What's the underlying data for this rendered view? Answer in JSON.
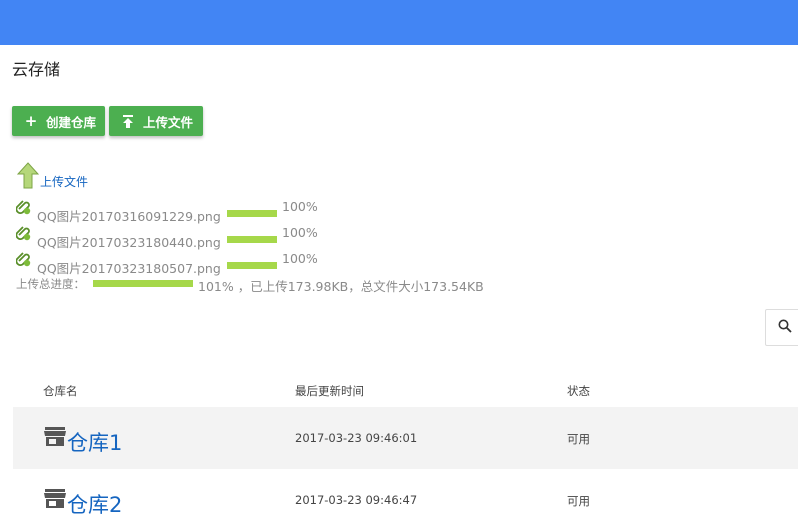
{
  "header": {
    "title": "云存储",
    "bar_color": "#4285f4"
  },
  "toolbar": {
    "create_repo_label": "创建仓库",
    "upload_file_label": "上传文件",
    "create_icon": "plus-icon",
    "upload_icon": "upload-icon"
  },
  "uploader": {
    "link_label": "上传文件",
    "files": [
      {
        "name": "QQ图片20170316091229.png",
        "percent_label": "100%",
        "progress": 1.0
      },
      {
        "name": "QQ图片20170323180440.png",
        "percent_label": "100%",
        "progress": 1.0
      },
      {
        "name": "QQ图片20170323180507.png",
        "percent_label": "100%",
        "progress": 1.0
      }
    ],
    "total": {
      "label": "上传总进度：",
      "summary": "101% ，已上传173.98KB，总文件大小173.54KB",
      "progress": 1.0
    }
  },
  "search": {
    "icon": "search-icon"
  },
  "table": {
    "headers": [
      "仓库名",
      "最后更新时间",
      "状态"
    ],
    "rows": [
      {
        "name": "仓库1",
        "updated": "2017-03-23 09:46:01",
        "status": "可用"
      },
      {
        "name": "仓库2",
        "updated": "2017-03-23 09:46:47",
        "status": "可用"
      }
    ]
  }
}
